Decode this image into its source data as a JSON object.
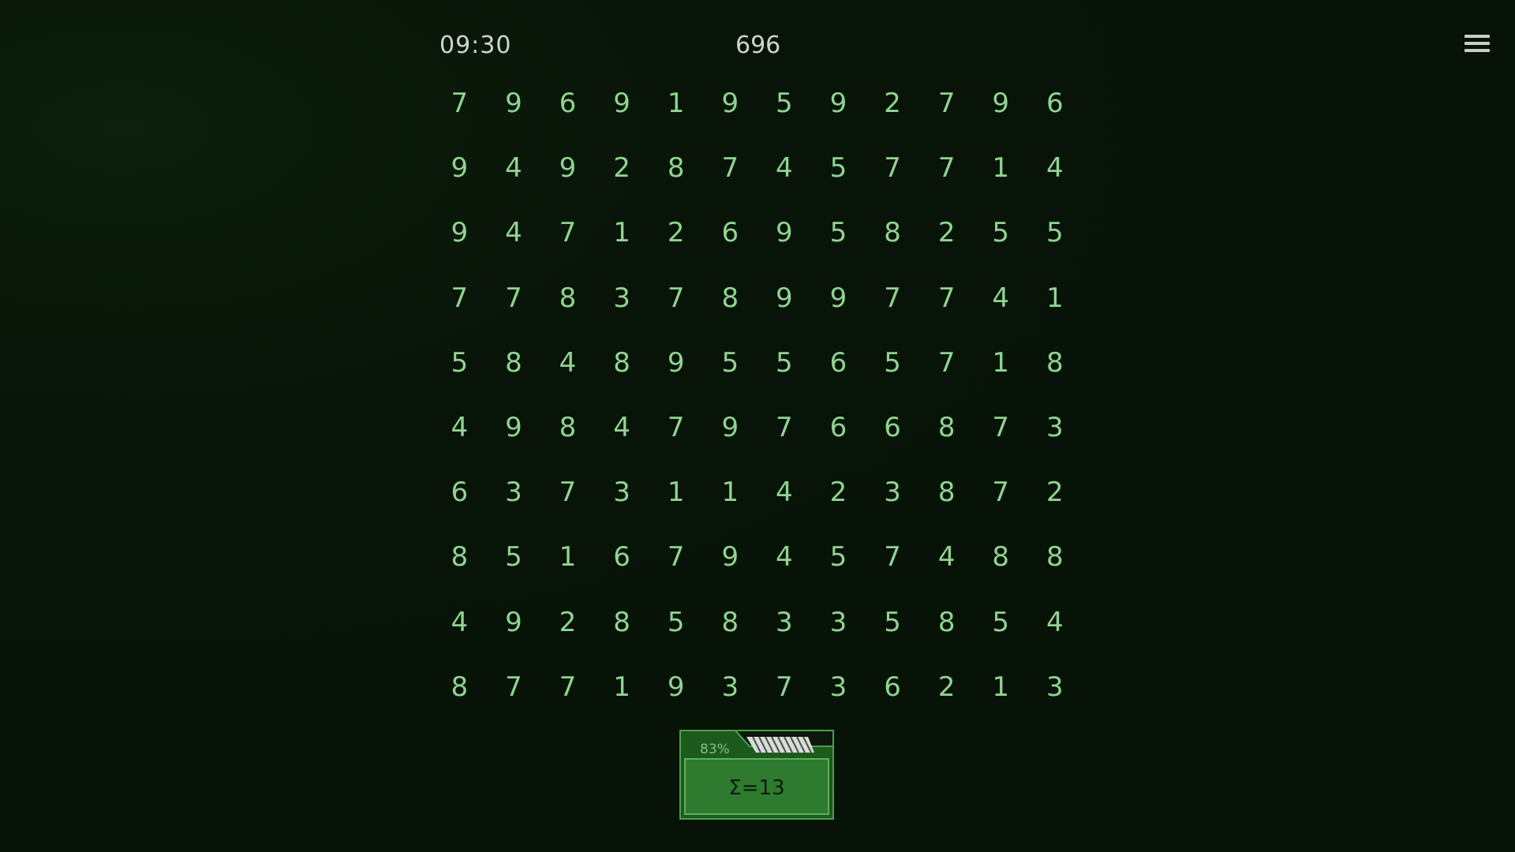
{
  "header": {
    "timer": "09:30",
    "score": "696",
    "menu_icon": "hamburger-menu-icon"
  },
  "grid": {
    "rows": [
      [
        "7",
        "9",
        "6",
        "9",
        "1",
        "9",
        "5",
        "9",
        "2",
        "7",
        "9",
        "6"
      ],
      [
        "9",
        "4",
        "9",
        "2",
        "8",
        "7",
        "4",
        "5",
        "7",
        "7",
        "1",
        "4"
      ],
      [
        "9",
        "4",
        "7",
        "1",
        "2",
        "6",
        "9",
        "5",
        "8",
        "2",
        "5",
        "5"
      ],
      [
        "7",
        "7",
        "8",
        "3",
        "7",
        "8",
        "9",
        "9",
        "7",
        "7",
        "4",
        "1"
      ],
      [
        "5",
        "8",
        "4",
        "8",
        "9",
        "5",
        "5",
        "6",
        "5",
        "7",
        "1",
        "8"
      ],
      [
        "4",
        "9",
        "8",
        "4",
        "7",
        "9",
        "7",
        "6",
        "6",
        "8",
        "7",
        "3"
      ],
      [
        "6",
        "3",
        "7",
        "3",
        "1",
        "1",
        "4",
        "2",
        "3",
        "8",
        "7",
        "2"
      ],
      [
        "8",
        "5",
        "1",
        "6",
        "7",
        "9",
        "4",
        "5",
        "7",
        "4",
        "8",
        "8"
      ],
      [
        "4",
        "9",
        "2",
        "8",
        "5",
        "8",
        "3",
        "3",
        "5",
        "8",
        "5",
        "4"
      ],
      [
        "8",
        "7",
        "7",
        "1",
        "9",
        "3",
        "7",
        "3",
        "6",
        "2",
        "1",
        "3"
      ]
    ]
  },
  "bin": {
    "fill_percent": "83%",
    "label": "Σ=13"
  },
  "colors": {
    "background": "#081408",
    "digit": "#8fd48f",
    "bin_fill": "#2e7a2e",
    "bin_border": "#4aa04a"
  }
}
